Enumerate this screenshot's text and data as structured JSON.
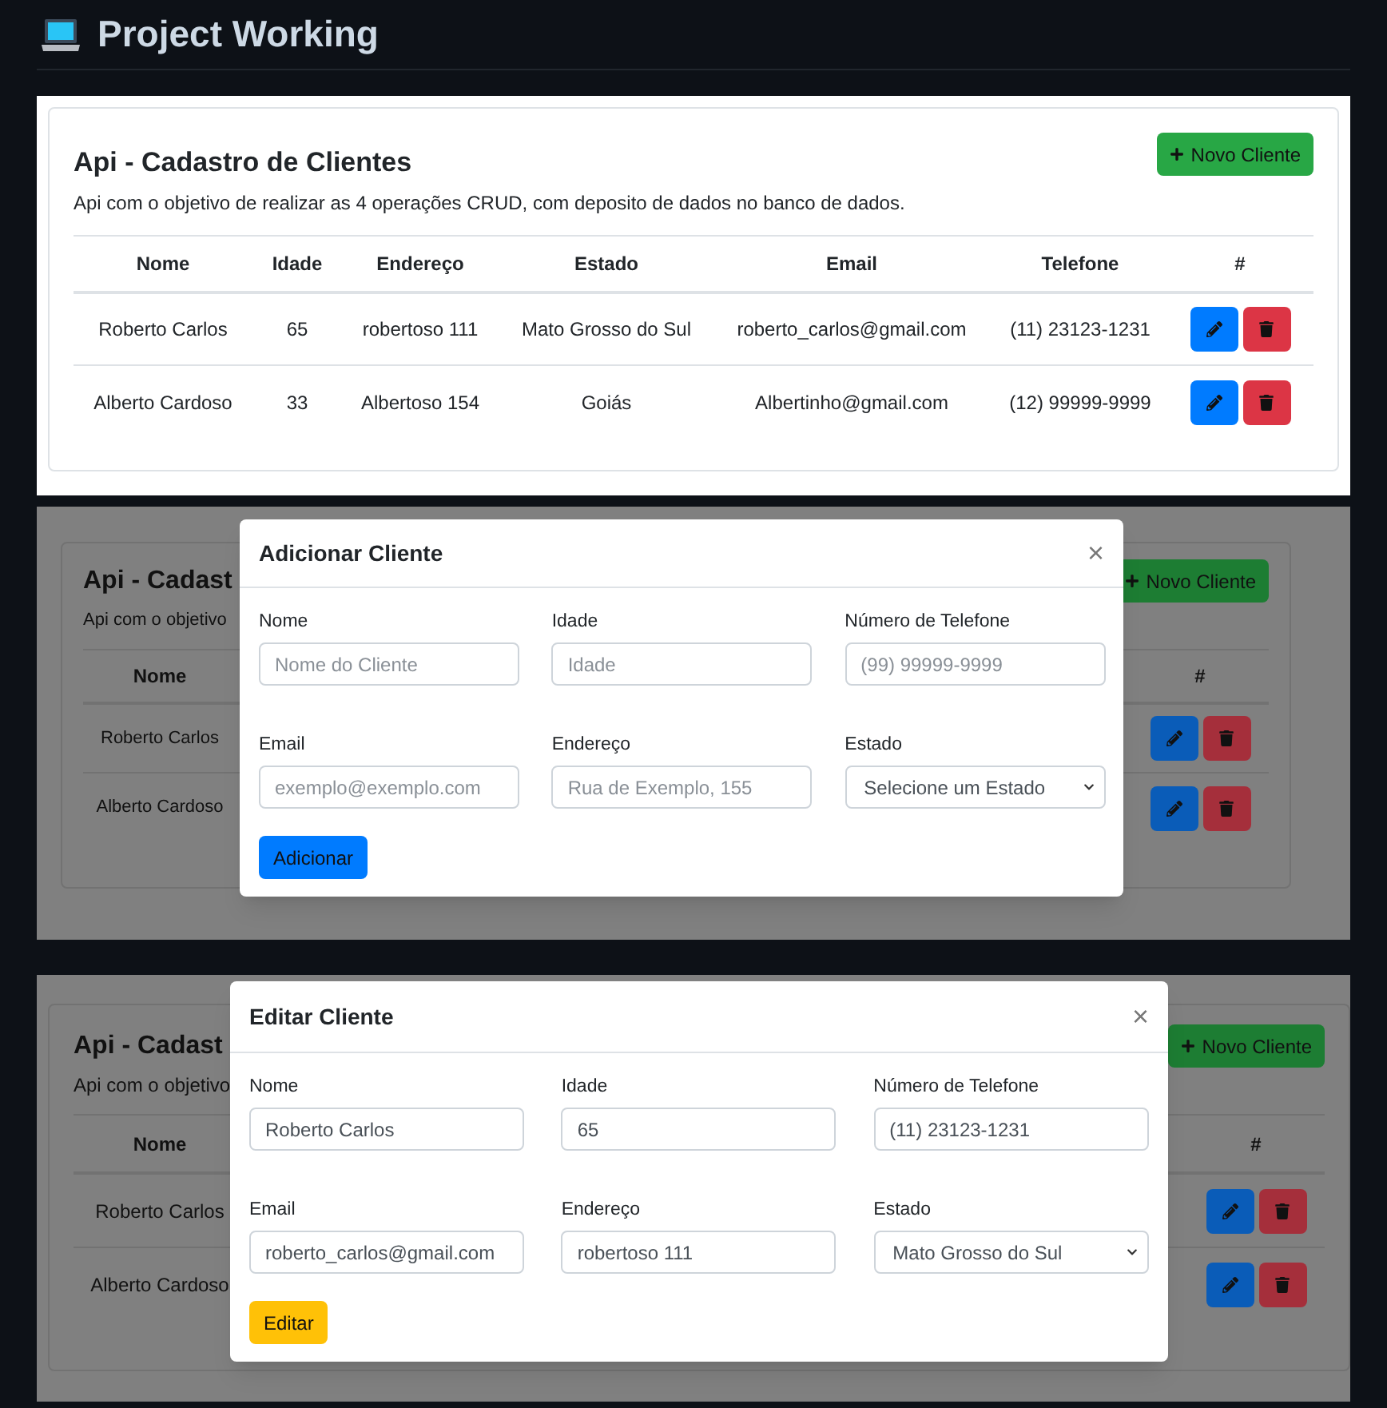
{
  "page_title": "Project Working",
  "screens": [
    {
      "kind": "list",
      "card": {
        "title": "Api - Cadastro de Clientes",
        "description": "Api com o objetivo de realizar as 4 operações CRUD, com deposito de dados no banco de dados.",
        "add_button": "Novo Cliente",
        "columns": [
          "Nome",
          "Idade",
          "Endereço",
          "Estado",
          "Email",
          "Telefone",
          "#"
        ],
        "rows": [
          {
            "cells": [
              "Roberto Carlos",
              "65",
              "robertoso 111",
              "Mato Grosso do Sul",
              "roberto_carlos@gmail.com",
              "(11) 23123-1231"
            ]
          },
          {
            "cells": [
              "Alberto Cardoso",
              "33",
              "Albertoso 154",
              "Goiás",
              "Albertinho@gmail.com",
              "(12) 99999-9999"
            ]
          }
        ]
      }
    },
    {
      "kind": "modal",
      "background": {
        "title": "Api - Cadast",
        "description": "Api com o objetivo",
        "add_button": "Novo Cliente",
        "columns": [
          "Nome",
          "#"
        ],
        "rows": [
          {
            "name": "Roberto Carlos"
          },
          {
            "name": "Alberto Cardoso"
          }
        ]
      },
      "modal": {
        "title": "Adicionar Cliente",
        "close": "×",
        "fields": [
          {
            "kind": "text",
            "label": "Nome",
            "placeholder": "Nome do Cliente"
          },
          {
            "kind": "text",
            "label": "Idade",
            "placeholder": "Idade"
          },
          {
            "kind": "text",
            "label": "Número de Telefone",
            "placeholder": "(99) 99999-9999"
          },
          {
            "kind": "text",
            "label": "Email",
            "placeholder": "exemplo@exemplo.com"
          },
          {
            "kind": "text",
            "label": "Endereço",
            "placeholder": "Rua de Exemplo, 155"
          },
          {
            "kind": "select",
            "label": "Estado",
            "value": "Selecione um Estado"
          }
        ],
        "submit": {
          "kind": "primary",
          "label": "Adicionar"
        }
      }
    },
    {
      "kind": "modal",
      "background": {
        "title": "Api - Cadast",
        "description": "Api com o objetivo",
        "add_button": "Novo Cliente",
        "columns": [
          "Nome",
          "#"
        ],
        "rows": [
          {
            "name": "Roberto Carlos"
          },
          {
            "name": "Alberto Cardoso"
          }
        ]
      },
      "modal": {
        "title": "Editar Cliente",
        "close": "×",
        "fields": [
          {
            "kind": "text",
            "label": "Nome",
            "value": "Roberto Carlos"
          },
          {
            "kind": "text",
            "label": "Idade",
            "value": "65"
          },
          {
            "kind": "text",
            "label": "Número de Telefone",
            "value": "(11) 23123-1231"
          },
          {
            "kind": "text",
            "label": "Email",
            "value": "roberto_carlos@gmail.com"
          },
          {
            "kind": "text",
            "label": "Endereço",
            "value": "robertoso 111"
          },
          {
            "kind": "select",
            "label": "Estado",
            "value": "Mato Grosso do Sul"
          }
        ],
        "submit": {
          "kind": "warning",
          "label": "Editar"
        }
      }
    }
  ]
}
